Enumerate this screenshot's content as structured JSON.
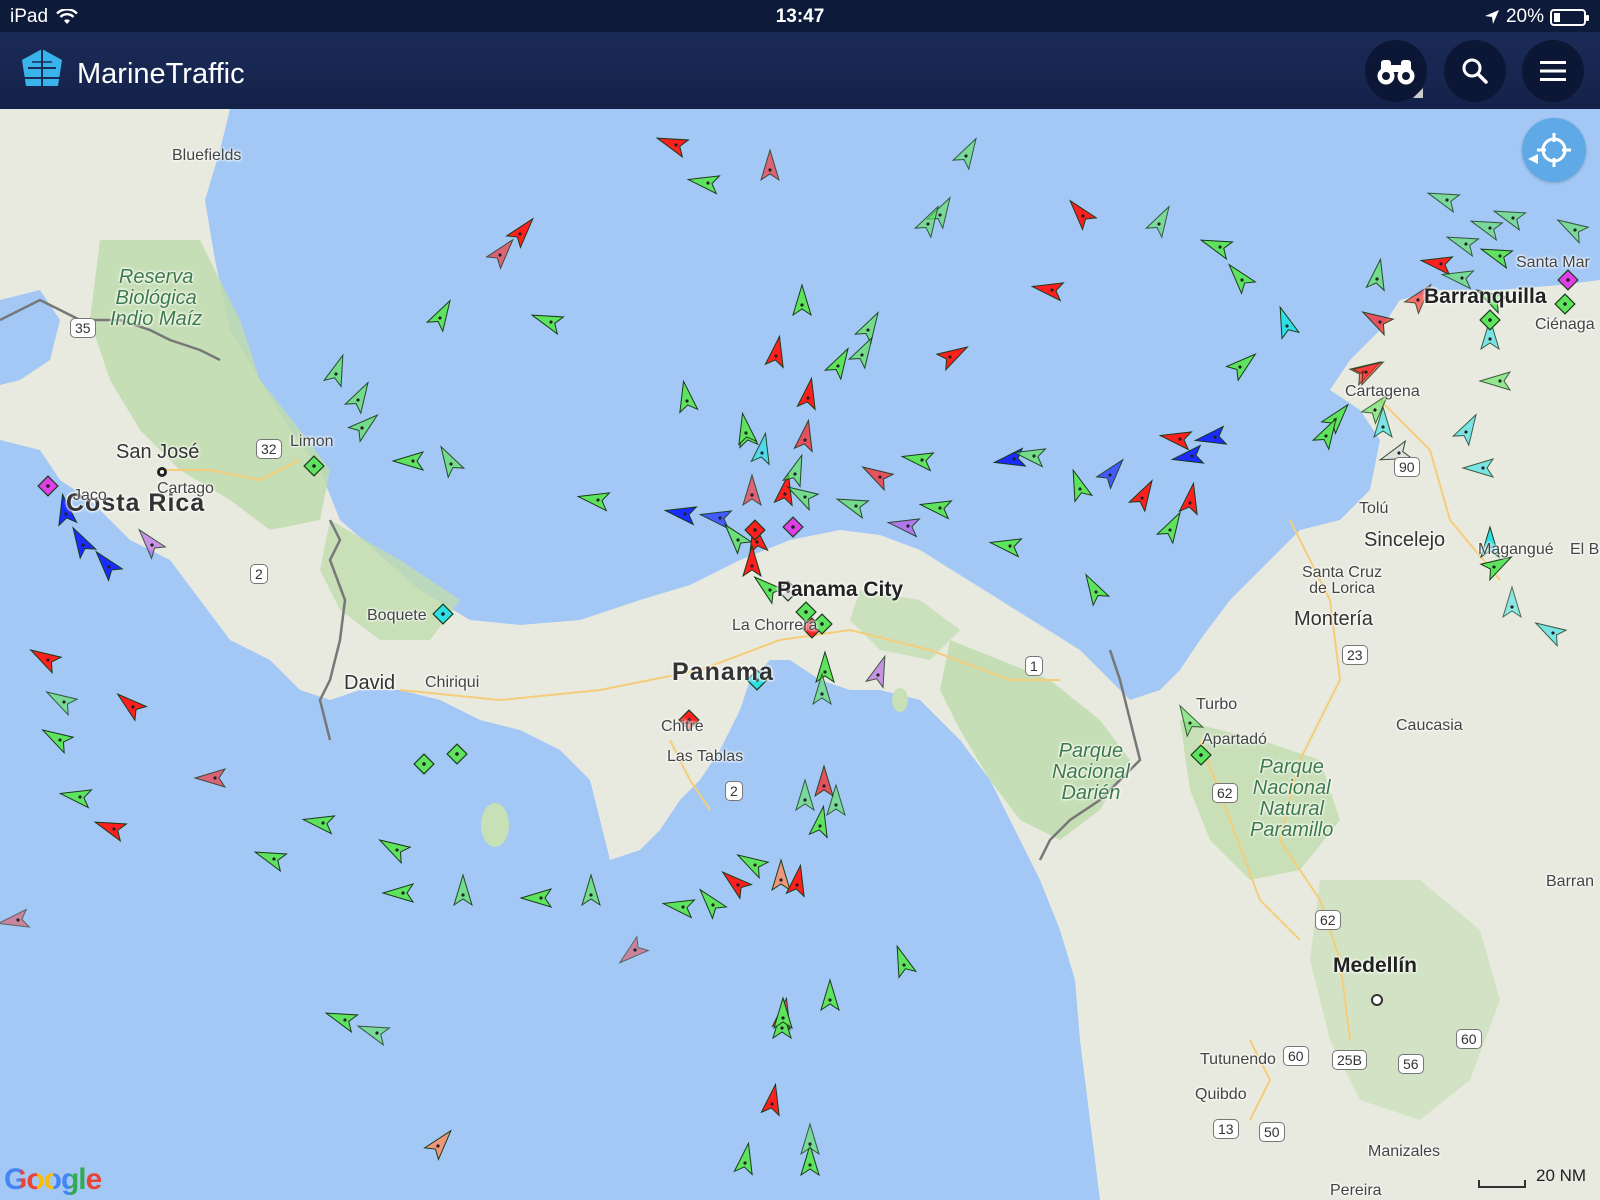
{
  "status_bar": {
    "device": "iPad",
    "time": "13:47",
    "battery": "20%",
    "battery_level": 0.2
  },
  "header": {
    "app_title": "MarineTraffic",
    "buttons": [
      {
        "id": "binoculars",
        "icon": "binoculars-icon"
      },
      {
        "id": "search",
        "icon": "search-icon"
      },
      {
        "id": "menu",
        "icon": "hamburger-menu-icon"
      }
    ]
  },
  "map": {
    "labels": {
      "costa_rica": "Costa Rica",
      "panama": "Panama",
      "san_jose": "San José",
      "panama_city": "Panama City",
      "cartagena": "Cartagena",
      "barranquilla": "Barranquilla",
      "santa_marta": "Santa Mar",
      "medellin": "Medellín",
      "bluefields": "Bluefields",
      "limon": "Limon",
      "cartago": "Cartago",
      "jaco": "Jaco",
      "boquete": "Boquete",
      "david": "David",
      "chiriqui": "Chiriqui",
      "la_chorrera": "La Chorrera",
      "chitre": "Chitre",
      "las_tablas": "Las Tablas",
      "cienaga": "Ciénaga",
      "tolu": "Tolú",
      "sincelejo": "Sincelejo",
      "magangue": "Magangué",
      "santa_cruz_de_lorica": "Santa Cruz\nde Lorica",
      "monteria": "Montería",
      "turbo": "Turbo",
      "apartado": "Apartadó",
      "caucasia": "Caucasia",
      "el_banco": "El Ba",
      "barranca": "Barran",
      "tutunendo": "Tutunendo",
      "quibdo": "Quibdo",
      "manizales": "Manizales",
      "pereira": "Pereira",
      "reserva": "Reserva\nBiológica\nIndio Maíz",
      "darien": "Parque\nNacional\nDarién",
      "paramillo": "Parque\nNacional\nNatural\nParamillo"
    },
    "road_shields": [
      "35",
      "32",
      "2",
      "1",
      "2",
      "90",
      "23",
      "62",
      "62",
      "60",
      "25B",
      "56",
      "60",
      "13",
      "50"
    ],
    "google_logo": "Google",
    "scale_label": "20 NM",
    "ship_legend_colors": {
      "cargo": "#5ee35e",
      "tanker": "#ff1f1f",
      "passenger": "#1a2cff",
      "tug_special": "#2ee0e6",
      "pleasure": "#e03ee6",
      "unspecified": "#dddddd"
    }
  }
}
